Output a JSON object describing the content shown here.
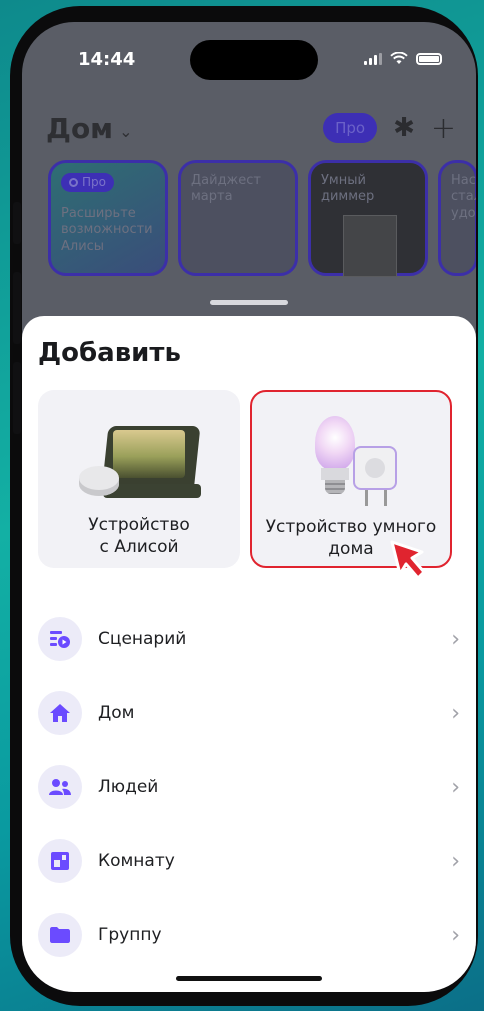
{
  "status_bar": {
    "time": "14:44"
  },
  "header": {
    "title": "Дом",
    "pro_label": "Про"
  },
  "stories": [
    {
      "badge": "Про",
      "text": "Расширьте возможности Алисы"
    },
    {
      "text": "Дайджест марта"
    },
    {
      "text": "Умный диммер"
    },
    {
      "text": "Нас стал удоб"
    }
  ],
  "sheet": {
    "title": "Добавить",
    "cards": [
      {
        "label_line1": "Устройство",
        "label_line2": "с Алисой"
      },
      {
        "label_line1": "Устройство умного",
        "label_line2": "дома"
      }
    ],
    "items": [
      {
        "label": "Сценарий",
        "icon": "scenario-icon"
      },
      {
        "label": "Дом",
        "icon": "home-icon"
      },
      {
        "label": "Людей",
        "icon": "people-icon"
      },
      {
        "label": "Комнату",
        "icon": "room-icon"
      },
      {
        "label": "Группу",
        "icon": "folder-icon"
      }
    ]
  },
  "colors": {
    "accent": "#6b4bff",
    "highlight": "#e0242f"
  }
}
